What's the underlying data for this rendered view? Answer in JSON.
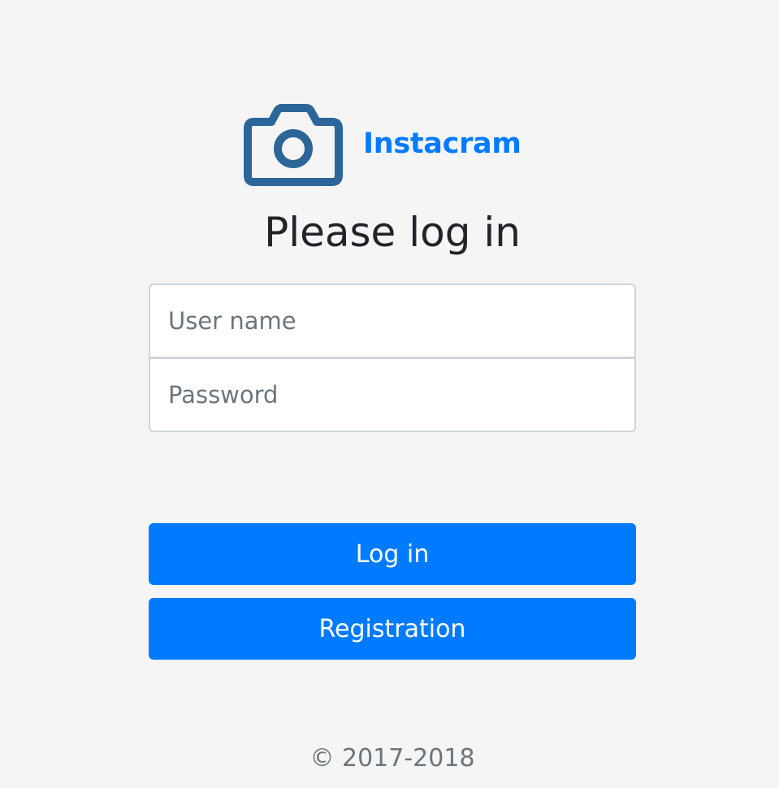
{
  "brand": {
    "name": "Instacram",
    "icon": "camera-icon",
    "color": "#007bff",
    "icon_color": "#2c6699"
  },
  "form": {
    "title": "Please log in",
    "username_placeholder": "User name",
    "username_value": "",
    "password_placeholder": "Password",
    "password_value": ""
  },
  "buttons": {
    "login_label": "Log in",
    "register_label": "Registration",
    "color": "#007bff"
  },
  "footer": {
    "copyright": "© 2017-2018"
  }
}
